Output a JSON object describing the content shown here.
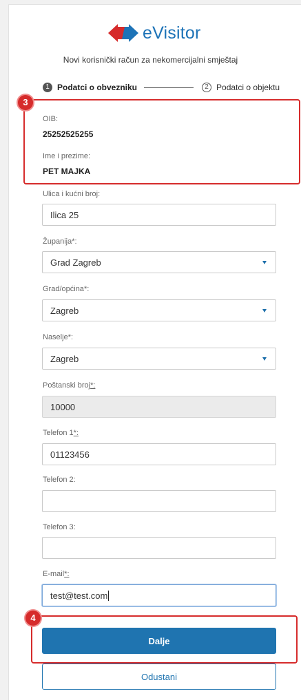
{
  "app": {
    "name": "eVisitor",
    "subtitle": "Novi korisnički račun za nekomercijalni smještaj"
  },
  "colors": {
    "brand_blue": "#1d73b7",
    "brand_red": "#d62b2b",
    "highlight": "#d62b2b"
  },
  "steps": [
    {
      "number": "1",
      "label": "Podatci o obvezniku",
      "active": true
    },
    {
      "number": "2",
      "label": "Podatci o objektu",
      "active": false
    }
  ],
  "readonly": {
    "oib_label": "OIB:",
    "oib_value": "25252525255",
    "name_label": "Ime i prezime:",
    "name_value": "PET MAJKA"
  },
  "form": {
    "street_label": "Ulica i kućni broj:",
    "street_value": "Ilica 25",
    "county_label": "Županija",
    "county_value": "Grad Zagreb",
    "city_label": "Grad/općina",
    "city_value": "Zagreb",
    "settlement_label": "Naselje",
    "settlement_value": "Zagreb",
    "postal_label": "Poštanski broj",
    "postal_value": "10000",
    "phone1_label": "Telefon 1",
    "phone1_value": "01123456",
    "phone2_label": "Telefon 2:",
    "phone2_value": "",
    "phone3_label": "Telefon 3:",
    "phone3_value": "",
    "email_label": "E-mail",
    "email_value": "test@test.com",
    "required_mark": "*:",
    "required_mark_short": "*"
  },
  "buttons": {
    "next": "Dalje",
    "cancel": "Odustani"
  },
  "annotations": {
    "badge_3": "3",
    "badge_4": "4"
  }
}
